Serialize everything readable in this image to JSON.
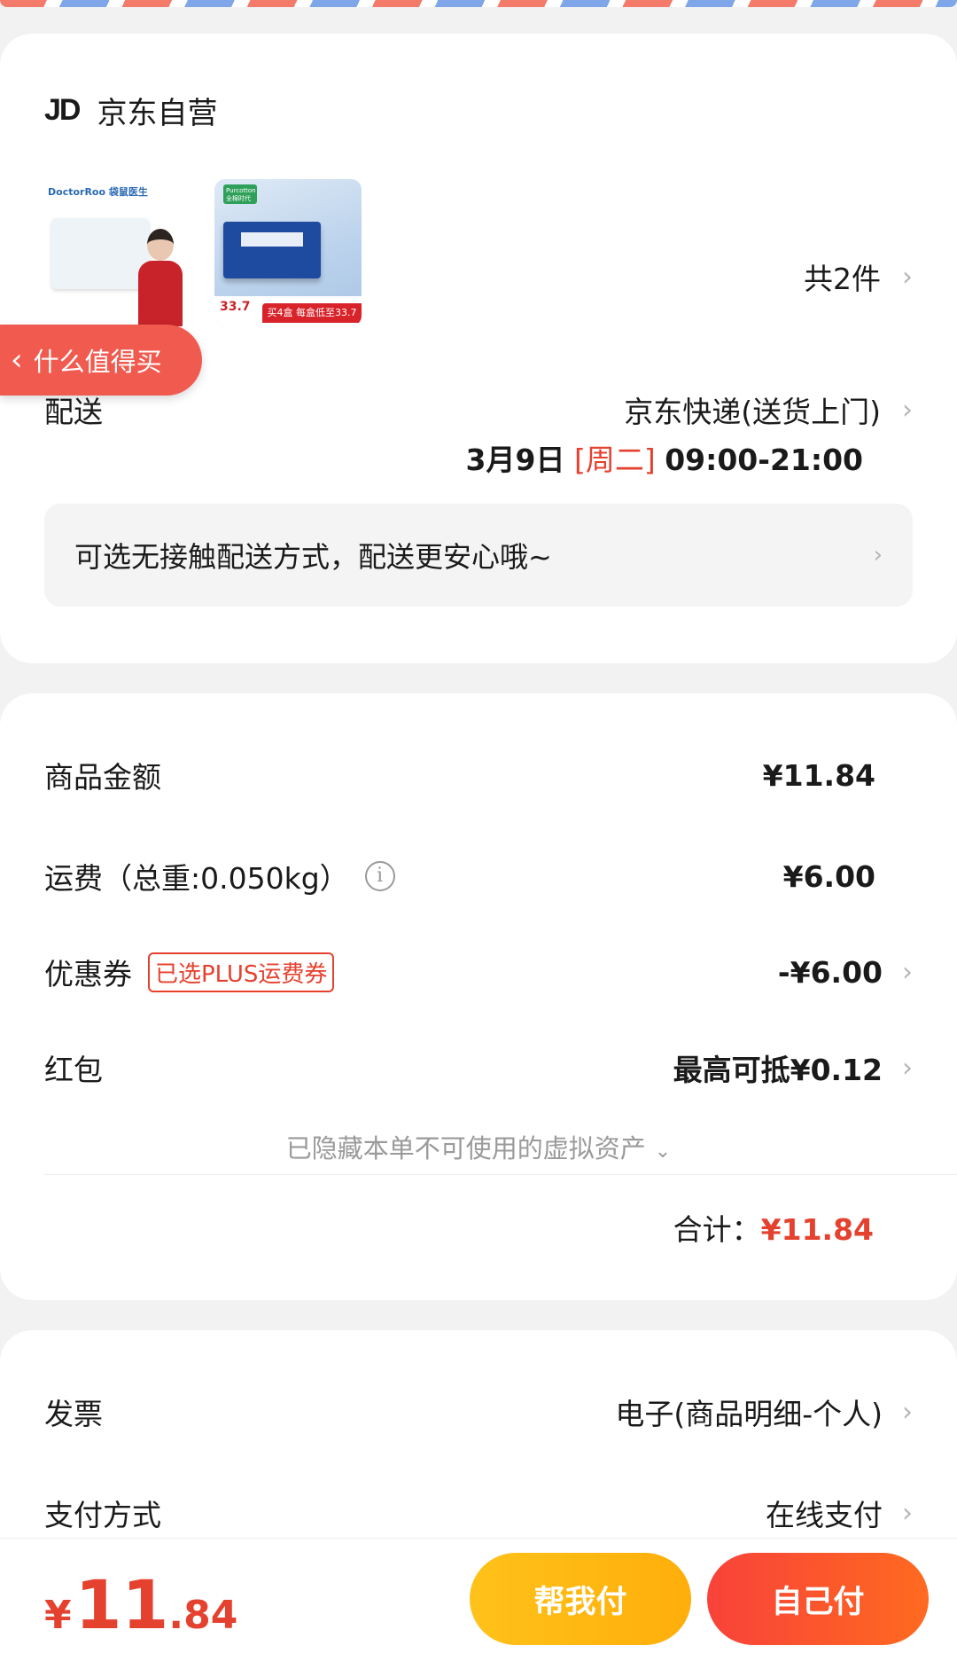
{
  "shop": {
    "logo_text": "JD",
    "name": "京东自营"
  },
  "products": {
    "thumb1": {
      "brand_text": "DoctorRoo 袋鼠医生"
    },
    "thumb2": {
      "tag_text": "Purcotton 全棉时代",
      "price_text": "33.7",
      "promo_text": "买4盒 每盒低至33.7"
    },
    "count_label": "共2件"
  },
  "floating_tag": {
    "label": "什么值得买"
  },
  "delivery": {
    "label": "配送",
    "method": "京东快递(送货上门)",
    "date": "3月9日",
    "weekday": "[周二]",
    "hours": "09:00-21:00"
  },
  "notice": {
    "text": "可选无接触配送方式，配送更安心哦~"
  },
  "pricing": {
    "goods_label": "商品金额",
    "goods_value": "¥11.84",
    "shipping_label": "运费（总重:0.050kg）",
    "shipping_value": "¥6.00",
    "coupon_label": "优惠券",
    "coupon_badge": "已选PLUS运费券",
    "coupon_value": "-¥6.00",
    "redpacket_label": "红包",
    "redpacket_value": "最高可抵¥0.12",
    "hidden_assets": "已隐藏本单不可使用的虚拟资产",
    "total_label": "合计：",
    "total_value": "¥11.84"
  },
  "invoice": {
    "label": "发票",
    "value": "电子(商品明细-个人)"
  },
  "payment": {
    "label": "支付方式",
    "value": "在线支付"
  },
  "footer": {
    "currency": "¥",
    "amount_int": "11",
    "amount_dec": ".84",
    "help_pay_label": "帮我付",
    "self_pay_label": "自己付"
  },
  "colors": {
    "accent_red": "#e5412f",
    "help_button": "#ffb812",
    "self_button": "#f8423a"
  },
  "icons": {
    "chevron": "chevron-right-icon",
    "info": "info-icon",
    "back": "chevron-left-icon",
    "dropdown": "chevron-down-icon"
  }
}
